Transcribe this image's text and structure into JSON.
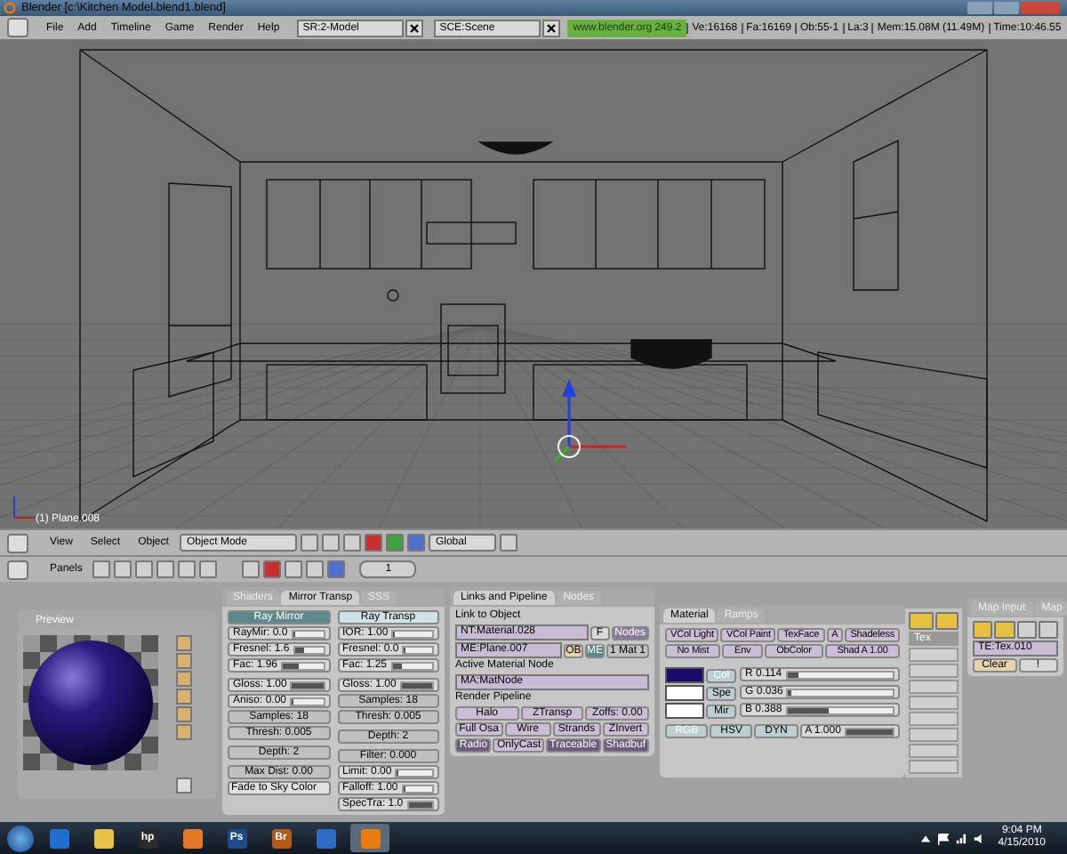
{
  "window": {
    "title": "Blender [c:\\Kitchen Model.blend1.blend]"
  },
  "menu": [
    "File",
    "Add",
    "Timeline",
    "Game",
    "Render",
    "Help"
  ],
  "screen_field": "SR:2-Model",
  "scene_field": "SCE:Scene",
  "website": "www.blender.org 249.2",
  "stats": [
    "Ve:16168",
    "Fa:16169",
    "Ob:55-1",
    "La:3",
    "Mem:15.08M (11.49M)",
    "Time:10:46.55"
  ],
  "viewport": {
    "object_label": "(1) Plane.008"
  },
  "view_header": {
    "menu": [
      "View",
      "Select",
      "Object"
    ],
    "mode": "Object Mode",
    "orientation": "Global"
  },
  "buttons_header": {
    "label": "Panels",
    "frame": "1"
  },
  "preview": {
    "title": "Preview"
  },
  "mirror_panel": {
    "tabs": [
      {
        "label": "Shaders",
        "selected": false
      },
      {
        "label": "Mirror Transp",
        "selected": true
      },
      {
        "label": "SSS",
        "selected": false
      }
    ],
    "columns": [
      [
        [
          {
            "kind": "toggle",
            "label": "Ray Mirror",
            "on": true
          },
          {
            "kind": "slider",
            "label": "RayMir: 0.0",
            "level": 0
          },
          {
            "kind": "slider",
            "label": "Fresnel: 1.6",
            "level": 0.32
          },
          {
            "kind": "slider",
            "label": "Fac: 1.96",
            "level": 0.4
          }
        ],
        [
          {
            "kind": "slider",
            "label": "Gloss: 1.00",
            "level": 1
          },
          {
            "kind": "slider",
            "label": "Aniso: 0.00",
            "level": 0
          },
          {
            "kind": "num",
            "label": "Samples: 18"
          },
          {
            "kind": "num",
            "label": "Thresh: 0.005"
          }
        ],
        [
          {
            "kind": "num",
            "label": "Depth: 2"
          }
        ],
        [
          {
            "kind": "num",
            "label": "Max Dist: 0.00"
          },
          {
            "kind": "menu",
            "label": "Fade to Sky Color"
          }
        ]
      ],
      [
        [
          {
            "kind": "toggle",
            "label": "Ray Transp",
            "on": false
          },
          {
            "kind": "slider",
            "label": "IOR: 1.00",
            "level": 0
          },
          {
            "kind": "slider",
            "label": "Fresnel: 0.0",
            "level": 0
          },
          {
            "kind": "slider",
            "label": "Fac: 1.25",
            "level": 0.25
          }
        ],
        [
          {
            "kind": "slider",
            "label": "Gloss: 1.00",
            "level": 1
          },
          {
            "kind": "num",
            "label": "Samples: 18"
          },
          {
            "kind": "num",
            "label": "Thresh: 0.005"
          }
        ],
        [
          {
            "kind": "num",
            "label": "Depth: 2"
          }
        ],
        [
          {
            "kind": "num",
            "label": "Filter: 0.000"
          },
          {
            "kind": "slider",
            "label": "Limit: 0.00",
            "level": 0
          },
          {
            "kind": "slider",
            "label": "Falloff: 1.00",
            "level": 0.1
          },
          {
            "kind": "slider",
            "label": "SpecTra: 1.0",
            "level": 1
          }
        ]
      ]
    ]
  },
  "links_panel": {
    "tabs": [
      {
        "label": "Links and Pipeline",
        "selected": true
      },
      {
        "label": "Nodes",
        "selected": false
      }
    ],
    "link_label": "Link to Object",
    "material_field": "NT:Material.028",
    "fake_user": "F",
    "nodes_button": "Nodes",
    "mesh_field": "ME:Plane.007",
    "owner_buttons": [
      {
        "label": "OB",
        "selected": false
      },
      {
        "label": "ME",
        "selected": true
      }
    ],
    "mat_count": "1 Mat 1",
    "node_label": "Active Material Node",
    "node_field": "MA:MatNode",
    "pipeline_label": "Render Pipeline",
    "pipeline": [
      [
        {
          "label": "Halo",
          "on": false
        },
        {
          "label": "ZTransp",
          "on": false
        },
        {
          "label": "Zoffs: 0.00",
          "on": false
        }
      ],
      [
        {
          "label": "Full Osa",
          "on": false
        },
        {
          "label": "Wire",
          "on": false
        },
        {
          "label": "Strands",
          "on": false
        },
        {
          "label": "ZInvert",
          "on": false
        }
      ],
      [
        {
          "label": "Radio",
          "on": true
        },
        {
          "label": "OnlyCast",
          "on": false
        },
        {
          "label": "Traceable",
          "on": true
        },
        {
          "label": "Shadbuf",
          "on": true
        }
      ]
    ]
  },
  "material_panel": {
    "tabs": [
      {
        "label": "Material",
        "selected": true
      },
      {
        "label": "Ramps",
        "selected": false
      }
    ],
    "options": [
      [
        {
          "label": "VCol Light",
          "on": false
        },
        {
          "label": "VCol Paint",
          "on": false
        },
        {
          "label": "TexFace",
          "on": false
        },
        {
          "label": "A",
          "on": false
        },
        {
          "label": "Shadeless",
          "on": false
        }
      ],
      [
        {
          "label": "No Mist",
          "on": false
        },
        {
          "label": "Env",
          "on": false
        },
        {
          "label": "ObColor",
          "on": false
        },
        {
          "label": "Shad A 1.00",
          "on": false
        }
      ]
    ],
    "colors": [
      {
        "label": "Col",
        "color": "#1a0a6e",
        "selected": true
      },
      {
        "label": "Spe",
        "color": "#ffffff",
        "selected": false
      },
      {
        "label": "Mir",
        "color": "#ffffff",
        "selected": false
      }
    ],
    "sliders": [
      {
        "label": "R 0.114",
        "level": 0.114
      },
      {
        "label": "G 0.036",
        "level": 0.036
      },
      {
        "label": "B 0.388",
        "level": 0.388
      }
    ],
    "modes": [
      {
        "label": "RGB",
        "selected": true
      },
      {
        "label": "HSV",
        "selected": false
      },
      {
        "label": "DYN",
        "selected": false
      }
    ],
    "alpha": {
      "label": "A 1.000",
      "level": 1
    }
  },
  "texture_channels": {
    "items": [
      {
        "label": "Tex",
        "selected": true
      }
    ]
  },
  "map_panel": {
    "tabs": [
      {
        "label": "Map Input",
        "selected": false
      },
      {
        "label": "Map",
        "selected": false
      }
    ],
    "texture_field": "TE:Tex.010",
    "clear_button": "Clear",
    "flag_button": "!"
  },
  "taskbar": {
    "apps": [
      {
        "kind": "ie",
        "selected": false
      },
      {
        "kind": "folder",
        "selected": false
      },
      {
        "kind": "hp",
        "label": "hp",
        "selected": false
      },
      {
        "kind": "media",
        "selected": false
      },
      {
        "kind": "ps",
        "label": "Ps",
        "selected": false
      },
      {
        "kind": "br",
        "label": "Br",
        "selected": false
      },
      {
        "kind": "check",
        "selected": false
      },
      {
        "kind": "blender",
        "selected": true
      }
    ],
    "time": "9:04 PM",
    "date": "4/15/2010"
  }
}
